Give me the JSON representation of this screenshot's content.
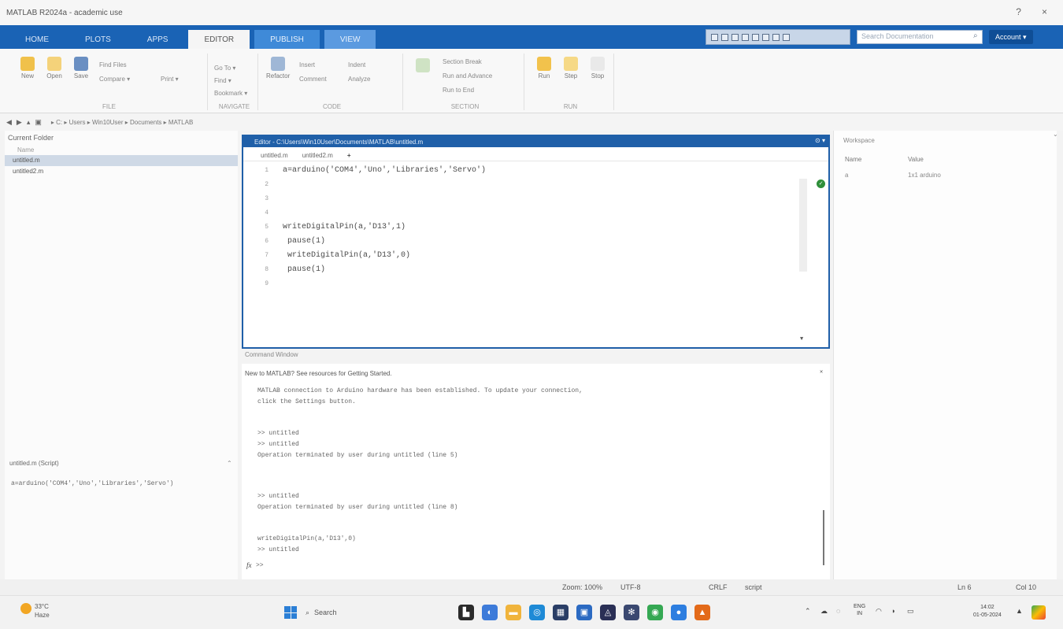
{
  "window": {
    "title": "MATLAB R2024a - academic use",
    "controls": [
      "?",
      "×"
    ]
  },
  "ribbon": {
    "tabs": [
      {
        "label": "HOME",
        "style": "blue"
      },
      {
        "label": "PLOTS",
        "style": "blue"
      },
      {
        "label": "APPS",
        "style": "blue"
      },
      {
        "label": "EDITOR",
        "style": "active"
      },
      {
        "label": "PUBLISH",
        "style": "light"
      },
      {
        "label": "VIEW",
        "style": "grey"
      }
    ],
    "search_placeholder": "Search Documentation",
    "account_label": "Account ▾"
  },
  "toolstrip": {
    "groups": [
      {
        "label": "FILE",
        "buttons": [
          "New",
          "Open",
          "Save"
        ],
        "small": [
          "Find Files",
          "Compare ▾",
          "Print ▾"
        ]
      },
      {
        "label": "NAVIGATE",
        "buttons": [
          "Go To ▾"
        ],
        "small": [
          "Find ▾",
          "Bookmark ▾"
        ]
      },
      {
        "label": "CODE",
        "buttons": [
          "Refactor",
          "Analyze"
        ],
        "small": [
          "Insert",
          "Comment",
          "Indent"
        ]
      },
      {
        "label": "SECTION",
        "buttons": [
          "Section Break",
          "Run and Advance",
          "Run to End"
        ],
        "small": []
      },
      {
        "label": "RUN",
        "buttons": [
          "Run",
          "Step",
          "Stop"
        ],
        "small": []
      }
    ]
  },
  "address": {
    "path": "▸ C: ▸ Users ▸ Win10User ▸ Documents ▸ MATLAB"
  },
  "current_folder": {
    "title": "Current Folder",
    "column": "Name",
    "files": [
      {
        "name": "untitled.m",
        "selected": true
      },
      {
        "name": "untitled2.m",
        "selected": false
      }
    ],
    "details_title": "untitled.m (Script)",
    "details_text": "a=arduino('COM4','Uno','Libraries','Servo')"
  },
  "editor": {
    "title": "Editor - C:\\Users\\Win10User\\Documents\\MATLAB\\untitled.m",
    "tabs": [
      "untitled.m",
      "untitled2.m",
      "+"
    ],
    "lines": [
      {
        "num": "1",
        "text": "a=arduino('COM4','Uno','Libraries','Servo')"
      },
      {
        "num": "2",
        "text": ""
      },
      {
        "num": "3",
        "text": ""
      },
      {
        "num": "4",
        "text": ""
      },
      {
        "num": "5",
        "text": "writeDigitalPin(a,'D13',1)"
      },
      {
        "num": "6",
        "text": " pause(1)"
      },
      {
        "num": "7",
        "text": " writeDigitalPin(a,'D13',0)"
      },
      {
        "num": "8",
        "text": " pause(1)"
      },
      {
        "num": "9",
        "text": ""
      }
    ]
  },
  "command_window": {
    "header": "Command Window",
    "banner": "New to MATLAB? See resources for Getting Started.",
    "intro_1": "MATLAB connection to Arduino hardware has been established. To update your connection,",
    "intro_2": "click the Settings button.",
    "entries": [
      ">> untitled",
      ">> untitled",
      "Operation terminated by user during untitled (line 5)",
      ">> untitled",
      "Operation terminated by user during untitled (line 8)",
      "writeDigitalPin(a,'D13',0)",
      ">> untitled"
    ],
    "prompt": ">>",
    "fx": "fx"
  },
  "workspace": {
    "title": "Workspace",
    "columns": [
      "Name",
      "Value"
    ],
    "rows": [
      {
        "name": "a",
        "value": "1x1 arduino"
      }
    ]
  },
  "status": {
    "zoom": "Zoom: 100%",
    "encoding": "UTF-8",
    "eol": "CRLF",
    "file_type": "script",
    "line": "Ln 6",
    "col": "Col 10"
  },
  "taskbar": {
    "weather_temp": "33°C",
    "weather_desc": "Haze",
    "search_label": "Search",
    "lang_1": "ENG",
    "lang_2": "IN",
    "time": "14:02",
    "date": "01-05-2024"
  },
  "colors": {
    "ribbon_blue": "#1a63b5",
    "editor_border": "#1f5fa8",
    "ok_green": "#2f8f3a"
  }
}
